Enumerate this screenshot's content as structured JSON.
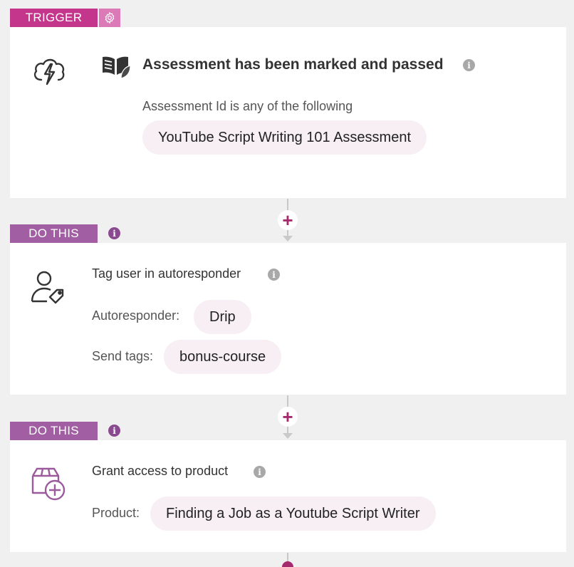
{
  "trigger": {
    "label": "TRIGGER",
    "settings_icon": "gear-icon",
    "event_icon": "lightning-cloud-icon",
    "app_icon": "open-book-leaf-icon",
    "title": "Assessment has been marked and passed",
    "condition_text": "Assessment Id is any of the following",
    "value": "YouTube Script Writing 101 Assessment"
  },
  "action1": {
    "label": "DO THIS",
    "icon": "user-tag-icon",
    "title": "Tag user in autoresponder",
    "autoresponder_label": "Autoresponder:",
    "autoresponder_value": "Drip",
    "tags_label": "Send tags:",
    "tags_value": "bonus-course"
  },
  "action2": {
    "label": "DO THIS",
    "icon": "box-add-icon",
    "title": "Grant access to product",
    "product_label": "Product:",
    "product_value": "Finding a Job as a Youtube Script Writer"
  },
  "connectors": {
    "add_symbol": "+"
  },
  "colors": {
    "trigger": "#c4358c",
    "do_this": "#a25ea3",
    "plus": "#a52a6e",
    "pill_bg": "#f7eff3",
    "background": "#f0f0f0"
  }
}
